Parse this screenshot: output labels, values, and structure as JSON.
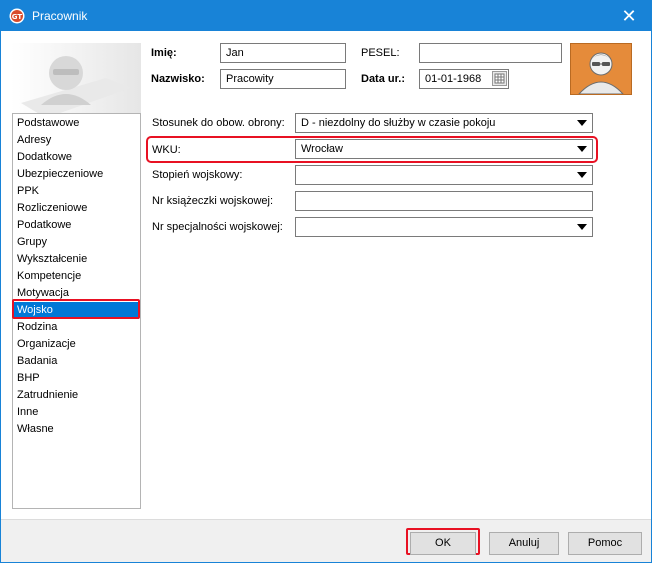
{
  "window": {
    "title": "Pracownik",
    "close_glyph": "✕",
    "app_icon": "app-logo-icon"
  },
  "header": {
    "first_name_label": "Imię:",
    "first_name_value": "Jan",
    "last_name_label": "Nazwisko:",
    "last_name_value": "Pracowity",
    "pesel_label": "PESEL:",
    "pesel_value": "",
    "birth_date_label": "Data ur.:",
    "birth_date_value": "01-01-1968",
    "photo_icon": "person-photo-icon",
    "decor_icon": "person-watermark-icon"
  },
  "nav": {
    "items": [
      {
        "label": "Podstawowe"
      },
      {
        "label": "Adresy"
      },
      {
        "label": "Dodatkowe"
      },
      {
        "label": "Ubezpieczeniowe"
      },
      {
        "label": "PPK"
      },
      {
        "label": "Rozliczeniowe"
      },
      {
        "label": "Podatkowe"
      },
      {
        "label": "Grupy"
      },
      {
        "label": "Wykształcenie"
      },
      {
        "label": "Kompetencje"
      },
      {
        "label": "Motywacja"
      },
      {
        "label": "Wojsko"
      },
      {
        "label": "Rodzina"
      },
      {
        "label": "Organizacje"
      },
      {
        "label": "Badania"
      },
      {
        "label": "BHP"
      },
      {
        "label": "Zatrudnienie"
      },
      {
        "label": "Inne"
      },
      {
        "label": "Własne"
      }
    ],
    "selected": "Wojsko"
  },
  "form": {
    "stosunek_label": "Stosunek do obow. obrony:",
    "stosunek_value": "D - niezdolny do służby w czasie pokoju",
    "wku_label": "WKU:",
    "wku_value": "Wrocław",
    "stopien_label": "Stopień wojskowy:",
    "stopien_value": "",
    "ksiazeczka_label": "Nr książeczki wojskowej:",
    "ksiazeczka_value": "",
    "specjalnosc_label": "Nr specjalności wojskowej:",
    "specjalnosc_value": ""
  },
  "footer": {
    "ok_label": "OK",
    "cancel_label": "Anuluj",
    "help_label": "Pomoc"
  },
  "colors": {
    "titlebar": "#1883d7",
    "selection": "#0078d7",
    "highlight_outline": "#e81123",
    "photo_bg": "#e58b3a"
  }
}
